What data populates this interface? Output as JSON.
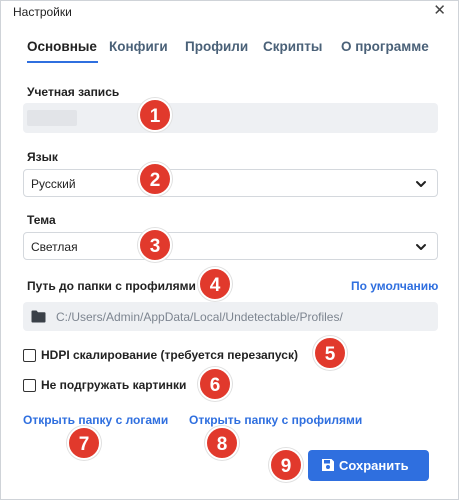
{
  "window": {
    "title": "Настройки",
    "close_symbol": "✕"
  },
  "tabs": [
    {
      "label": "Основные",
      "active": true
    },
    {
      "label": "Конфиги",
      "active": false
    },
    {
      "label": "Профили",
      "active": false
    },
    {
      "label": "Скрипты",
      "active": false
    },
    {
      "label": "О программе",
      "active": false
    }
  ],
  "account": {
    "label": "Учетная запись",
    "value": ""
  },
  "language": {
    "label": "Язык",
    "value": "Русский"
  },
  "theme": {
    "label": "Тема",
    "value": "Светлая"
  },
  "profiles_folder": {
    "label": "Путь до папки с профилями",
    "default_link": "По умолчанию",
    "path": "C:/Users/Admin/AppData/Local/Undetectable/Profiles/"
  },
  "options": [
    {
      "label": "HDPI скалирование (требуется перезапуск)",
      "checked": false
    },
    {
      "label": "Не подгружать картинки",
      "checked": false
    }
  ],
  "links": {
    "open_logs": "Открыть папку с логами",
    "open_profiles": "Открыть папку с профилями"
  },
  "save_button": {
    "label": "Сохранить"
  },
  "markers": [
    "1",
    "2",
    "3",
    "4",
    "5",
    "6",
    "7",
    "8",
    "9"
  ],
  "colors": {
    "accent": "#2f6fdf",
    "marker": "#e1392c",
    "field_bg": "#eef0f3"
  }
}
